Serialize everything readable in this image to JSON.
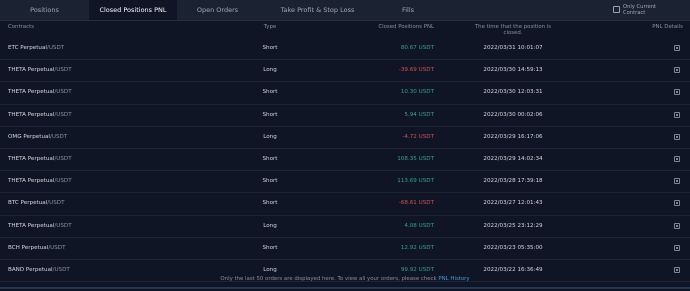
{
  "tabs": [
    {
      "label": "Positions"
    },
    {
      "label": "Closed Positions PNL"
    },
    {
      "label": "Open Orders"
    },
    {
      "label": "Take Profit & Stop Loss"
    },
    {
      "label": "Fills"
    }
  ],
  "active_tab": "Closed Positions PNL",
  "only_current_contract_label": "Only Current Contract",
  "table": {
    "headers": {
      "contracts": "Contracts",
      "type": "Type",
      "pnl": "Closed Positions PNL",
      "time": "The time that the position is closed.",
      "details": "PNL Details"
    },
    "rows": [
      {
        "contract": "ETC Perpetual",
        "quote": "/USDT",
        "type": "Short",
        "pnl": "80.67 USDT",
        "pnl_sign": "pos",
        "time": "2022/03/31 10:01:07"
      },
      {
        "contract": "THETA Perpetual",
        "quote": "/USDT",
        "type": "Long",
        "pnl": "-39.69 USDT",
        "pnl_sign": "neg",
        "time": "2022/03/30 14:59:13"
      },
      {
        "contract": "THETA Perpetual",
        "quote": "/USDT",
        "type": "Short",
        "pnl": "10.30 USDT",
        "pnl_sign": "pos",
        "time": "2022/03/30 12:03:31"
      },
      {
        "contract": "THETA Perpetual",
        "quote": "/USDT",
        "type": "Short",
        "pnl": "5.94 USDT",
        "pnl_sign": "pos",
        "time": "2022/03/30 00:02:06"
      },
      {
        "contract": "OMG Perpetual",
        "quote": "/USDT",
        "type": "Long",
        "pnl": "-4.72 USDT",
        "pnl_sign": "neg",
        "time": "2022/03/29 16:17:06"
      },
      {
        "contract": "THETA Perpetual",
        "quote": "/USDT",
        "type": "Short",
        "pnl": "108.35 USDT",
        "pnl_sign": "pos",
        "time": "2022/03/29 14:02:34"
      },
      {
        "contract": "THETA Perpetual",
        "quote": "/USDT",
        "type": "Short",
        "pnl": "113.69 USDT",
        "pnl_sign": "pos",
        "time": "2022/03/28 17:39:18"
      },
      {
        "contract": "BTC Perpetual",
        "quote": "/USDT",
        "type": "Short",
        "pnl": "-68.61 USDT",
        "pnl_sign": "neg",
        "time": "2022/03/27 12:01:43"
      },
      {
        "contract": "THETA Perpetual",
        "quote": "/USDT",
        "type": "Long",
        "pnl": "4.08 USDT",
        "pnl_sign": "pos",
        "time": "2022/03/25 23:12:29"
      },
      {
        "contract": "BCH Perpetual",
        "quote": "/USDT",
        "type": "Short",
        "pnl": "12.92 USDT",
        "pnl_sign": "pos",
        "time": "2022/03/23 05:35:00"
      },
      {
        "contract": "BAND Perpetual",
        "quote": "/USDT",
        "type": "Long",
        "pnl": "99.92 USDT",
        "pnl_sign": "pos",
        "time": "2022/03/22 16:36:49"
      }
    ]
  },
  "footer": {
    "text": "Only the last 50 orders are displayed here. To view all your orders, please check",
    "link": "PNL History"
  },
  "colors": {
    "positive": "#2ea689",
    "negative": "#d85050",
    "link": "#39a0dd"
  },
  "icons": {
    "details": "document-icon",
    "checkbox": "checkbox-icon"
  }
}
